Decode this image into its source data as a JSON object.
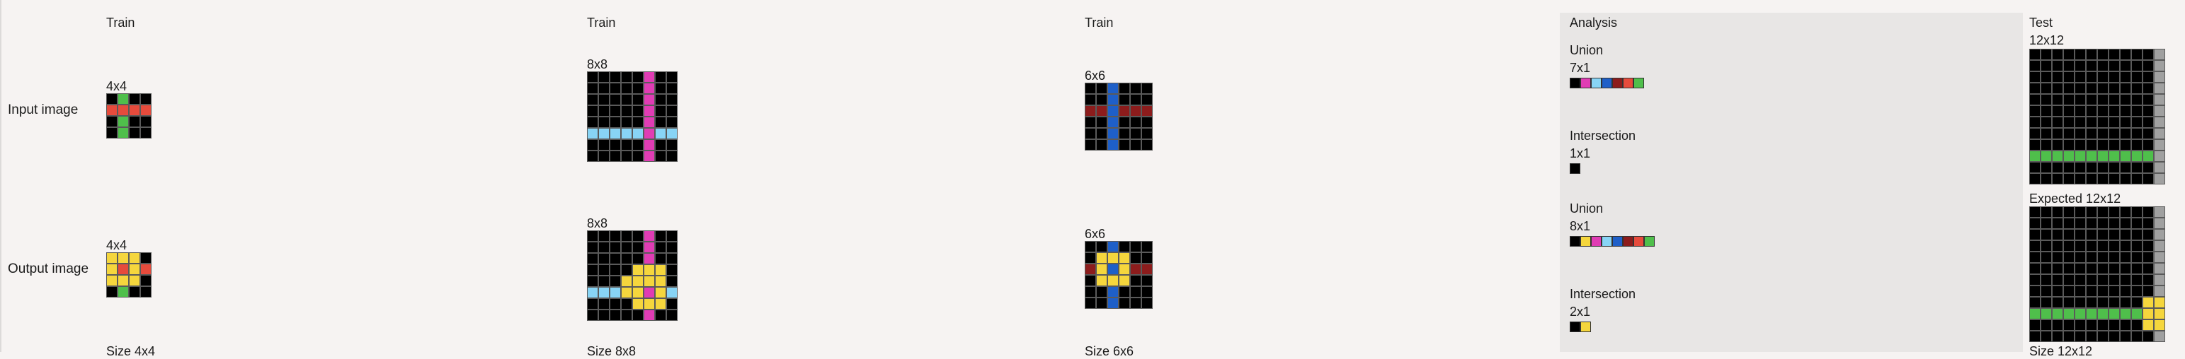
{
  "palette": {
    "0": "#000000",
    "1": "#1e5fc8",
    "2": "#e64b3c",
    "3": "#4fbf4b",
    "4": "#f5d63d",
    "5": "#a0a0a0",
    "6": "#e03cb4",
    "7": "#e8792a",
    "8": "#88d4f5",
    "9": "#8c1c1c"
  },
  "row_labels": {
    "input": "Input image",
    "output": "Output image"
  },
  "pairs": [
    {
      "header": "Train",
      "input": {
        "size": "4x4",
        "rows": [
          [
            0,
            3,
            0,
            0
          ],
          [
            2,
            2,
            2,
            2
          ],
          [
            0,
            3,
            0,
            0
          ],
          [
            0,
            3,
            0,
            0
          ]
        ]
      },
      "output": {
        "size": "4x4",
        "rows": [
          [
            4,
            4,
            4,
            0
          ],
          [
            4,
            2,
            4,
            2
          ],
          [
            4,
            4,
            4,
            0
          ],
          [
            0,
            3,
            0,
            0
          ]
        ]
      },
      "footer": "Size 4x4"
    },
    {
      "header": "Train",
      "input": {
        "size": "8x8",
        "rows": [
          [
            0,
            0,
            0,
            0,
            0,
            6,
            0,
            0
          ],
          [
            0,
            0,
            0,
            0,
            0,
            6,
            0,
            0
          ],
          [
            0,
            0,
            0,
            0,
            0,
            6,
            0,
            0
          ],
          [
            0,
            0,
            0,
            0,
            0,
            6,
            0,
            0
          ],
          [
            0,
            0,
            0,
            0,
            0,
            6,
            0,
            0
          ],
          [
            8,
            8,
            8,
            8,
            8,
            6,
            8,
            8
          ],
          [
            0,
            0,
            0,
            0,
            0,
            6,
            0,
            0
          ],
          [
            0,
            0,
            0,
            0,
            0,
            6,
            0,
            0
          ]
        ]
      },
      "output": {
        "size": "8x8",
        "rows": [
          [
            0,
            0,
            0,
            0,
            0,
            6,
            0,
            0
          ],
          [
            0,
            0,
            0,
            0,
            0,
            6,
            0,
            0
          ],
          [
            0,
            0,
            0,
            0,
            0,
            6,
            0,
            0
          ],
          [
            0,
            0,
            0,
            0,
            4,
            4,
            4,
            0
          ],
          [
            0,
            0,
            0,
            4,
            4,
            4,
            4,
            0
          ],
          [
            8,
            8,
            8,
            4,
            4,
            6,
            4,
            8
          ],
          [
            0,
            0,
            0,
            0,
            4,
            4,
            4,
            0
          ],
          [
            0,
            0,
            0,
            0,
            0,
            6,
            0,
            0
          ]
        ]
      },
      "footer": "Size 8x8"
    },
    {
      "header": "Train",
      "input": {
        "size": "6x6",
        "rows": [
          [
            0,
            0,
            1,
            0,
            0,
            0
          ],
          [
            0,
            0,
            1,
            0,
            0,
            0
          ],
          [
            9,
            9,
            1,
            9,
            9,
            9
          ],
          [
            0,
            0,
            1,
            0,
            0,
            0
          ],
          [
            0,
            0,
            1,
            0,
            0,
            0
          ],
          [
            0,
            0,
            1,
            0,
            0,
            0
          ]
        ]
      },
      "output": {
        "size": "6x6",
        "rows": [
          [
            0,
            0,
            1,
            0,
            0,
            0
          ],
          [
            0,
            4,
            4,
            4,
            0,
            0
          ],
          [
            9,
            4,
            1,
            4,
            9,
            9
          ],
          [
            0,
            4,
            4,
            4,
            0,
            0
          ],
          [
            0,
            0,
            1,
            0,
            0,
            0
          ],
          [
            0,
            0,
            1,
            0,
            0,
            0
          ]
        ]
      },
      "footer": "Size 6x6"
    }
  ],
  "analysis": {
    "header": "Analysis",
    "input_union": {
      "title": "Union",
      "size": "7x1",
      "colors": [
        0,
        6,
        8,
        1,
        9,
        2,
        3
      ]
    },
    "input_intersection": {
      "title": "Intersection",
      "size": "1x1",
      "colors": [
        0
      ]
    },
    "output_union": {
      "title": "Union",
      "size": "8x1",
      "colors": [
        0,
        4,
        6,
        8,
        1,
        9,
        2,
        3
      ]
    },
    "output_intersection": {
      "title": "Intersection",
      "size": "2x1",
      "colors": [
        0,
        4
      ]
    }
  },
  "test": {
    "header": "Test",
    "input": {
      "size": "12x12",
      "rows": [
        [
          0,
          0,
          0,
          0,
          0,
          0,
          0,
          0,
          0,
          0,
          0,
          5
        ],
        [
          0,
          0,
          0,
          0,
          0,
          0,
          0,
          0,
          0,
          0,
          0,
          5
        ],
        [
          0,
          0,
          0,
          0,
          0,
          0,
          0,
          0,
          0,
          0,
          0,
          5
        ],
        [
          0,
          0,
          0,
          0,
          0,
          0,
          0,
          0,
          0,
          0,
          0,
          5
        ],
        [
          0,
          0,
          0,
          0,
          0,
          0,
          0,
          0,
          0,
          0,
          0,
          5
        ],
        [
          0,
          0,
          0,
          0,
          0,
          0,
          0,
          0,
          0,
          0,
          0,
          5
        ],
        [
          0,
          0,
          0,
          0,
          0,
          0,
          0,
          0,
          0,
          0,
          0,
          5
        ],
        [
          0,
          0,
          0,
          0,
          0,
          0,
          0,
          0,
          0,
          0,
          0,
          5
        ],
        [
          0,
          0,
          0,
          0,
          0,
          0,
          0,
          0,
          0,
          0,
          0,
          5
        ],
        [
          3,
          3,
          3,
          3,
          3,
          3,
          3,
          3,
          3,
          3,
          3,
          5
        ],
        [
          0,
          0,
          0,
          0,
          0,
          0,
          0,
          0,
          0,
          0,
          0,
          5
        ],
        [
          0,
          0,
          0,
          0,
          0,
          0,
          0,
          0,
          0,
          0,
          0,
          5
        ]
      ]
    },
    "expected": {
      "label": "Expected 12x12",
      "rows": [
        [
          0,
          0,
          0,
          0,
          0,
          0,
          0,
          0,
          0,
          0,
          0,
          5
        ],
        [
          0,
          0,
          0,
          0,
          0,
          0,
          0,
          0,
          0,
          0,
          0,
          5
        ],
        [
          0,
          0,
          0,
          0,
          0,
          0,
          0,
          0,
          0,
          0,
          0,
          5
        ],
        [
          0,
          0,
          0,
          0,
          0,
          0,
          0,
          0,
          0,
          0,
          0,
          5
        ],
        [
          0,
          0,
          0,
          0,
          0,
          0,
          0,
          0,
          0,
          0,
          0,
          5
        ],
        [
          0,
          0,
          0,
          0,
          0,
          0,
          0,
          0,
          0,
          0,
          0,
          5
        ],
        [
          0,
          0,
          0,
          0,
          0,
          0,
          0,
          0,
          0,
          0,
          0,
          5
        ],
        [
          0,
          0,
          0,
          0,
          0,
          0,
          0,
          0,
          0,
          0,
          0,
          5
        ],
        [
          0,
          0,
          0,
          0,
          0,
          0,
          0,
          0,
          0,
          0,
          4,
          4
        ],
        [
          3,
          3,
          3,
          3,
          3,
          3,
          3,
          3,
          3,
          3,
          4,
          4
        ],
        [
          0,
          0,
          0,
          0,
          0,
          0,
          0,
          0,
          0,
          0,
          4,
          4
        ],
        [
          0,
          0,
          0,
          0,
          0,
          0,
          0,
          0,
          0,
          0,
          0,
          5
        ]
      ]
    },
    "footer": "Size 12x12"
  }
}
